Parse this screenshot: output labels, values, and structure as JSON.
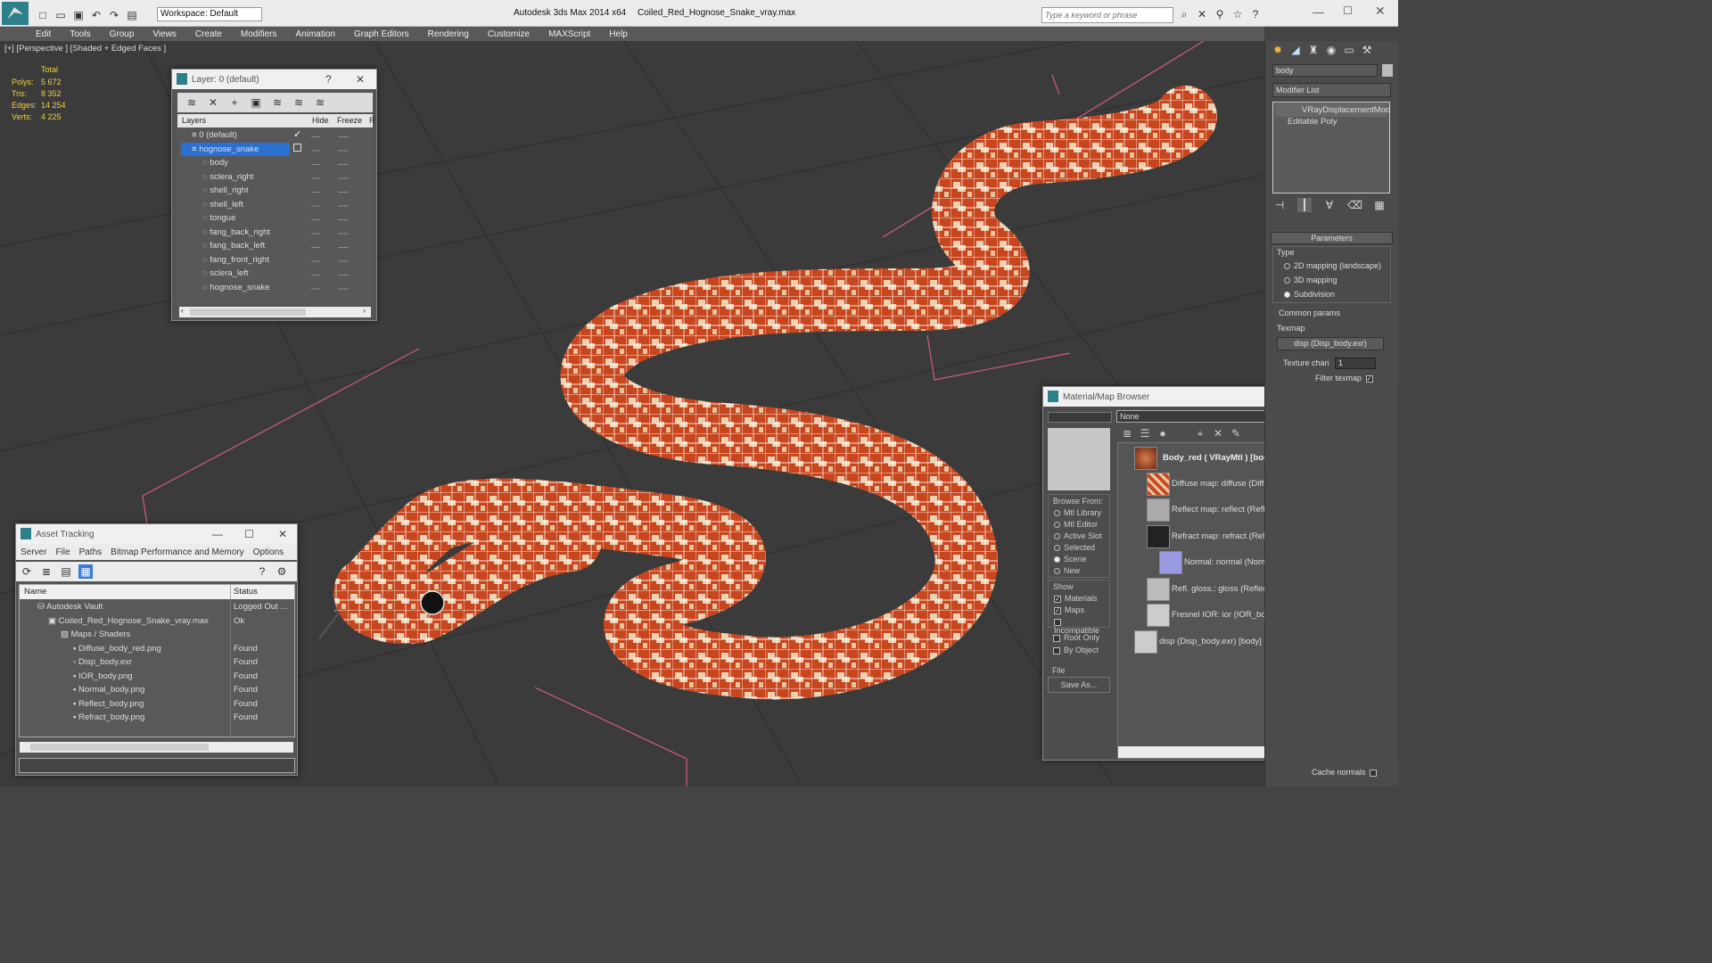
{
  "app": {
    "title": "Autodesk 3ds Max  2014 x64",
    "file": "Coiled_Red_Hognose_Snake_vray.max",
    "workspace": "Workspace: Default",
    "search_placeholder": "Type a keyword or phrase"
  },
  "menu": [
    "Edit",
    "Tools",
    "Group",
    "Views",
    "Create",
    "Modifiers",
    "Animation",
    "Graph Editors",
    "Rendering",
    "Customize",
    "MAXScript",
    "Help"
  ],
  "viewport": {
    "label": "[+] [Perspective ] [Shaded + Edged Faces ]",
    "stats": {
      "total": "Total",
      "rows": [
        {
          "k": "Polys:",
          "v": "5 672"
        },
        {
          "k": "Tris:",
          "v": "8 352"
        },
        {
          "k": "Edges:",
          "v": "14 254"
        },
        {
          "k": "Verts:",
          "v": "4 225"
        }
      ]
    }
  },
  "layer": {
    "title": "Layer: 0 (default)",
    "q": "?",
    "cols": {
      "layers": "Layers",
      "hide": "Hide",
      "freeze": "Freeze",
      "r": "R"
    },
    "items": [
      "0 (default)",
      "hognose_snake",
      "body",
      "sclera_right",
      "shell_right",
      "shell_left",
      "tongue",
      "fang_back_right",
      "fang_back_left",
      "fang_front_right",
      "sclera_left",
      "hognose_snake"
    ]
  },
  "asset": {
    "title": "Asset Tracking",
    "menu": [
      "Server",
      "File",
      "Paths",
      "Bitmap Performance and Memory",
      "Options"
    ],
    "cols": {
      "name": "Name",
      "status": "Status"
    },
    "rows": [
      {
        "n": "Autodesk Vault",
        "s": "Logged Out ..."
      },
      {
        "n": "Coiled_Red_Hognose_Snake_vray.max",
        "s": "Ok"
      },
      {
        "n": "Maps / Shaders",
        "s": ""
      },
      {
        "n": "Diffuse_body_red.png",
        "s": "Found"
      },
      {
        "n": "Disp_body.exr",
        "s": "Found"
      },
      {
        "n": "IOR_body.png",
        "s": "Found"
      },
      {
        "n": "Normal_body.png",
        "s": "Found"
      },
      {
        "n": "Reflect_body.png",
        "s": "Found"
      },
      {
        "n": "Refract_body.png",
        "s": "Found"
      }
    ]
  },
  "mat": {
    "title": "Material/Map Browser",
    "filter": "None",
    "browse_from": "Browse From:",
    "browse": [
      "Mtl Library",
      "Mtl Editor",
      "Active Slot",
      "Selected",
      "Scene",
      "New"
    ],
    "show": "Show",
    "show_items": [
      "Materials",
      "Maps",
      "Incompatible"
    ],
    "root_only": "Root Only",
    "by_object": "By Object",
    "file": "File",
    "save_as": "Save As...",
    "entries": [
      "Body_red  ( VRayMtl )  [body, fang_back_left, fang_",
      "Diffuse map: diffuse (Diffuse_body_red.png)",
      "Reflect map: reflect (Reflect_body.png)",
      "Refract map: refract (Refract_body.png)",
      "Normal: normal (Normal_body.png)",
      "Refl. gloss.: gloss (Reflect_body.png)",
      "Fresnel IOR: ior (IOR_body.png)",
      "disp (Disp_body.exr)  [body]"
    ]
  },
  "cmd": {
    "name": "body",
    "modifier_list": "Modifier List",
    "stack": [
      "VRayDisplacementMod",
      "Editable Poly"
    ],
    "parameters": "Parameters",
    "type": "Type",
    "types": [
      "2D mapping (landscape)",
      "3D mapping",
      "Subdivision"
    ],
    "common": "Common params",
    "texmap": "Texmap",
    "texmap_val": "disp (Disp_body.exr)",
    "tex_chan": "Texture chan",
    "tex_chan_val": "1",
    "filter": "Filter texmap",
    "cache": "Cache normals"
  },
  "colors": {
    "stats": "#f0d040",
    "selection": "#2b70d0",
    "grid": "#d05a82",
    "snake": "#c44a22",
    "wire": "#ffffff"
  }
}
